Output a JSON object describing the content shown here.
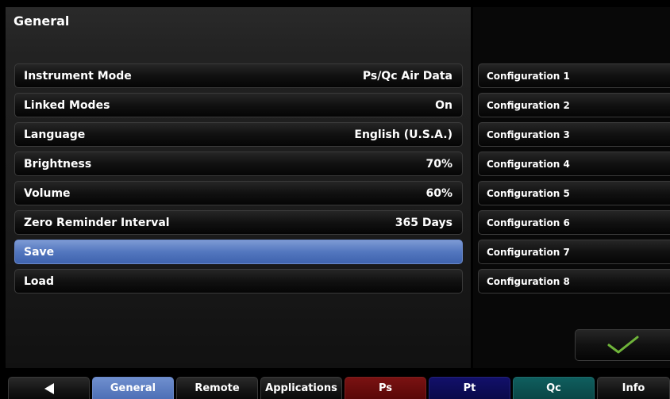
{
  "panel": {
    "title": "General"
  },
  "settings": [
    {
      "label": "Instrument Mode",
      "value": "Ps/Qc Air Data"
    },
    {
      "label": "Linked Modes",
      "value": "On"
    },
    {
      "label": "Language",
      "value": "English (U.S.A.)"
    },
    {
      "label": "Brightness",
      "value": "70%"
    },
    {
      "label": "Volume",
      "value": "60%"
    },
    {
      "label": "Zero Reminder Interval",
      "value": "365 Days"
    },
    {
      "label": "Save",
      "value": ""
    },
    {
      "label": "Load",
      "value": ""
    }
  ],
  "selected_setting": "Save",
  "configurations": [
    "Configuration 1",
    "Configuration 2",
    "Configuration 3",
    "Configuration 4",
    "Configuration 5",
    "Configuration 6",
    "Configuration 7",
    "Configuration 8"
  ],
  "ok_button": {
    "icon": "checkmark-icon"
  },
  "tabs": [
    {
      "label": "",
      "icon": "back-arrow-icon"
    },
    {
      "label": "General",
      "active": true
    },
    {
      "label": "Remote"
    },
    {
      "label": "Applications"
    },
    {
      "label": "Ps",
      "color": "#6a0d0d"
    },
    {
      "label": "Pt",
      "color": "#0f0d5a"
    },
    {
      "label": "Qc",
      "color": "#0c5252"
    },
    {
      "label": "Info"
    }
  ],
  "colors": {
    "selected": "#5377bf",
    "check": "#6fb43a"
  }
}
